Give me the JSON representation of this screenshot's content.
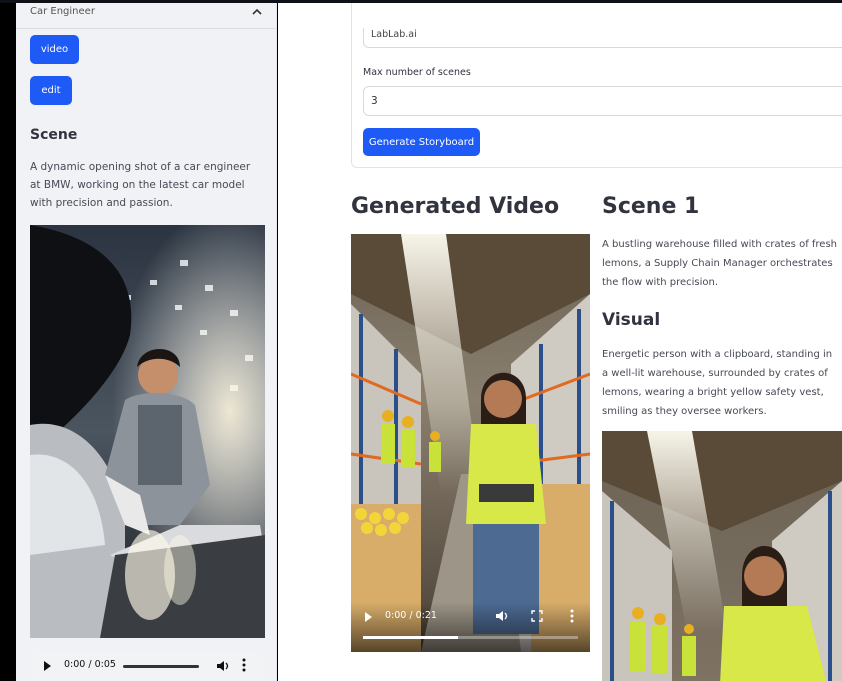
{
  "colors": {
    "accent": "#1e5af5",
    "sidebar_bg": "#f0f2f6",
    "text": "#31333f"
  },
  "sidebar": {
    "expander_title": "Car Engineer",
    "buttons": {
      "video": "video",
      "edit": "edit"
    },
    "scene_heading": "Scene",
    "scene_text": "A dynamic opening shot of a car engineer at BMW, working on the latest car model with precision and passion.",
    "image_icon": "car-engineer-image",
    "audio": {
      "time": "0:00 / 0:05"
    }
  },
  "form": {
    "top_input_value": "LabLab.ai",
    "max_scenes_label": "Max number of scenes",
    "max_scenes_value": "3",
    "generate_label": "Generate Storyboard"
  },
  "main": {
    "generated_video_heading": "Generated Video",
    "video": {
      "time": "0:00 / 0:21",
      "progress": 0.44
    },
    "scene_heading": "Scene 1",
    "scene_text": "A bustling warehouse filled with crates of fresh lemons, a Supply Chain Manager orchestrates the flow with precision.",
    "visual_heading": "Visual",
    "visual_text": "Energetic person with a clipboard, standing in a well-lit warehouse, surrounded by crates of lemons, wearing a bright yellow safety vest, smiling as they oversee workers."
  }
}
